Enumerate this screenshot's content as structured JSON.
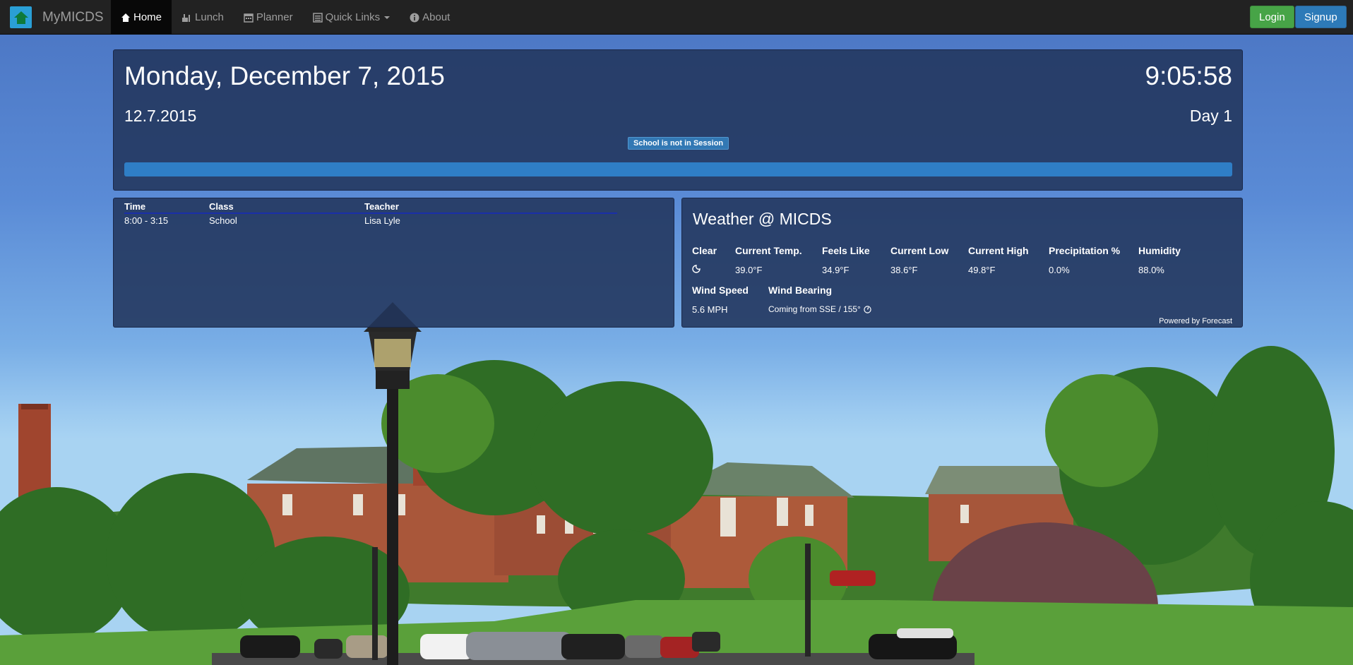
{
  "navbar": {
    "brand": "MyMICDS",
    "items": [
      {
        "label": "Home",
        "icon": "home-icon"
      },
      {
        "label": "Lunch",
        "icon": "lunch-icon"
      },
      {
        "label": "Planner",
        "icon": "calendar-icon"
      },
      {
        "label": "Quick Links",
        "icon": "list-icon"
      },
      {
        "label": "About",
        "icon": "info-icon"
      }
    ],
    "login_label": "Login",
    "signup_label": "Signup"
  },
  "date_panel": {
    "long_date": "Monday, December 7, 2015",
    "time": "9:05:58",
    "short_date": "12.7.2015",
    "day": "Day 1",
    "status": "School is not in Session",
    "progress_fraction": 1.0
  },
  "schedule": {
    "headers": [
      "Time",
      "Class",
      "Teacher"
    ],
    "rows": [
      {
        "time": "8:00 - 3:15",
        "class": "School",
        "teacher": "Lisa Lyle"
      }
    ]
  },
  "weather": {
    "title": "Weather @ MICDS",
    "labels": {
      "condition": "Clear",
      "current_temp": "Current Temp.",
      "feels_like": "Feels Like",
      "current_low": "Current Low",
      "current_high": "Current High",
      "precipitation": "Precipitation %",
      "humidity": "Humidity",
      "wind_speed": "Wind Speed",
      "wind_bearing": "Wind Bearing"
    },
    "values": {
      "condition_icon": "clear-night-icon",
      "current_temp": "39.0°F",
      "feels_like": "34.9°F",
      "current_low": "38.6°F",
      "current_high": "49.8°F",
      "precipitation": "0.0%",
      "humidity": "88.0%",
      "wind_speed": "5.6 MPH",
      "wind_bearing": "Coming from SSE / 155°"
    },
    "powered_by": "Powered by Forecast"
  }
}
